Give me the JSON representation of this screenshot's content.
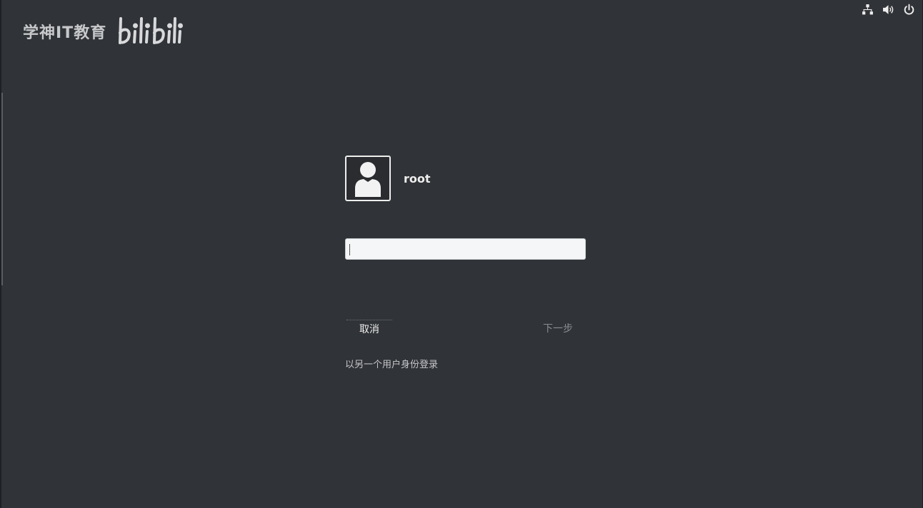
{
  "watermark": {
    "text": "学神IT教育",
    "logo_text": "bilibili"
  },
  "system_tray": {
    "icons": [
      "network-icon",
      "volume-icon",
      "power-icon"
    ]
  },
  "login": {
    "username": "root",
    "password": {
      "value": "",
      "placeholder": ""
    },
    "cancel_label": "取消",
    "next_label": "下一步",
    "switch_user_label": "以另一个用户身份登录"
  },
  "colors": {
    "background": "#303338",
    "text": "#eeeeec",
    "input_bg": "#f5f6f7",
    "disabled_text": "#8a8d91"
  }
}
